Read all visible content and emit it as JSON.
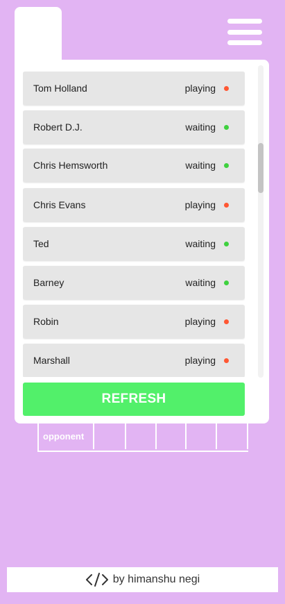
{
  "players": [
    {
      "name": "Tom Holland",
      "status": "playing",
      "color": "#ff5733"
    },
    {
      "name": "Robert D.J.",
      "status": "waiting",
      "color": "#3fd13f"
    },
    {
      "name": "Chris Hemsworth",
      "status": "waiting",
      "color": "#3fd13f"
    },
    {
      "name": "Chris Evans",
      "status": "playing",
      "color": "#ff5733"
    },
    {
      "name": "Ted",
      "status": "waiting",
      "color": "#3fd13f"
    },
    {
      "name": "Barney",
      "status": "waiting",
      "color": "#3fd13f"
    },
    {
      "name": "Robin",
      "status": "playing",
      "color": "#ff5733"
    },
    {
      "name": "Marshall",
      "status": "playing",
      "color": "#ff5733"
    }
  ],
  "refresh_label": "REFRESH",
  "board": {
    "cells": [
      "opponent",
      "",
      "",
      "",
      "",
      ""
    ]
  },
  "footer": {
    "text": "by himanshu negi",
    "icon": "code-icon"
  },
  "colors": {
    "background": "#e2b4f3",
    "accent_green": "#52f06a",
    "playing": "#ff5733",
    "waiting": "#3fd13f"
  }
}
